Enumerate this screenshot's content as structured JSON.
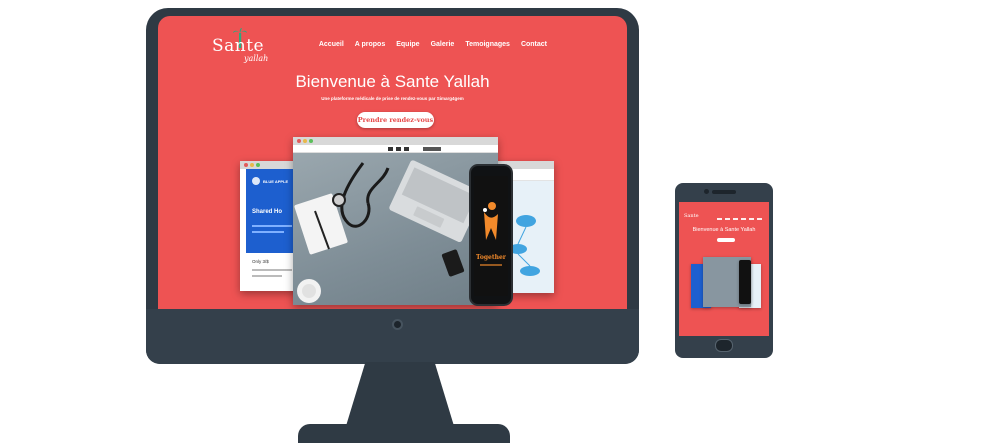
{
  "site": {
    "logo_main": "Sante",
    "logo_sub": "yallah",
    "nav": [
      "Accueil",
      "A propos",
      "Equipe",
      "Galerie",
      "Temoignages",
      "Contact"
    ],
    "hero_title": "Bienvenue à Sante Yallah",
    "hero_subtitle": "Une plateforme médicale de prise de rendez-vous par Simarg4gem",
    "cta_label": "Prendre rendez-vous"
  },
  "mockups": {
    "left_window": {
      "brand": "BLUE APPLE",
      "heading": "Shared Ho",
      "price": "Only 3/$"
    },
    "phone_screen": {
      "title": "Together"
    }
  },
  "mobile": {
    "logo": "Sante",
    "hero_title": "Bienvenue à Sante Yallah"
  },
  "colors": {
    "brand_red": "#ee5353",
    "device_dark": "#2f3a44",
    "logo_teal": "#2ea87e"
  }
}
